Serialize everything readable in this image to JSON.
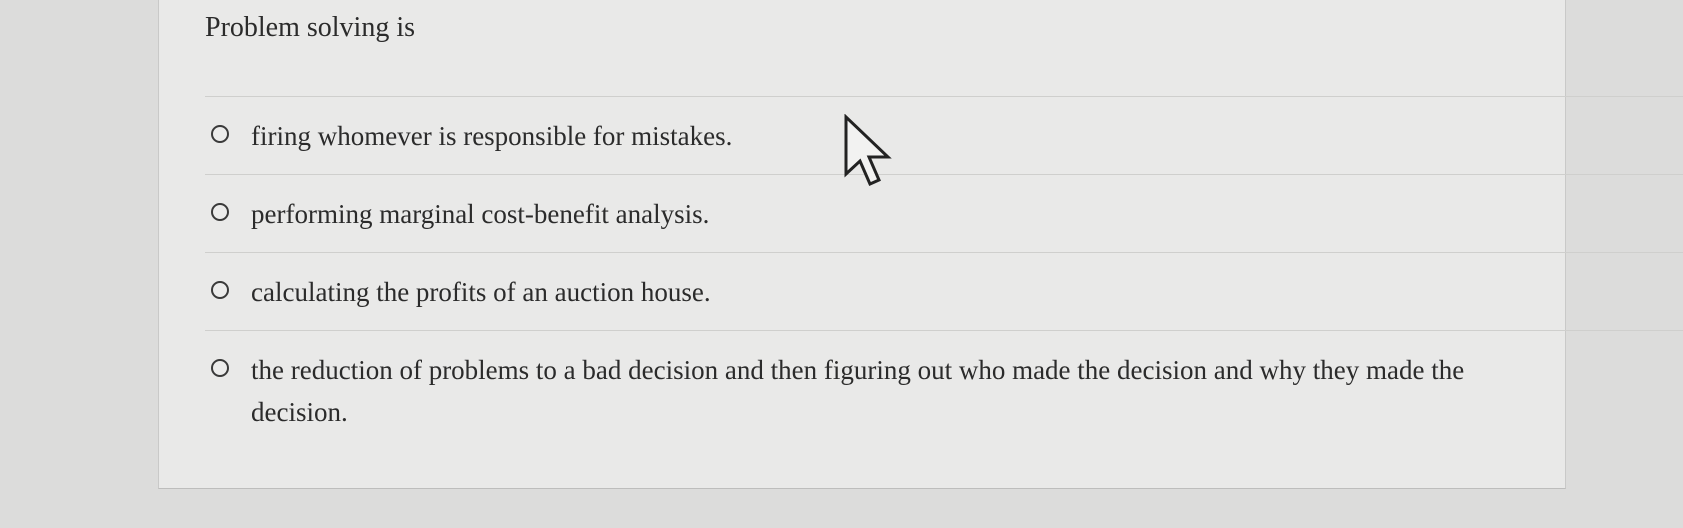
{
  "question": {
    "text": "Problem solving is"
  },
  "options": [
    {
      "label": "firing whomever is responsible for mistakes."
    },
    {
      "label": "performing marginal cost-benefit analysis."
    },
    {
      "label": "calculating the profits of an auction house."
    },
    {
      "label": "the reduction of problems to a bad decision and then figuring out who made the decision and why they made the decision."
    }
  ],
  "icons": {
    "cursor": "mouse-pointer-icon",
    "radio": "radio-button-icon"
  },
  "colors": {
    "background": "#dcdcdb",
    "panel": "#e9e9e8",
    "text": "#2b2b2b",
    "divider": "#cfcfcd"
  }
}
